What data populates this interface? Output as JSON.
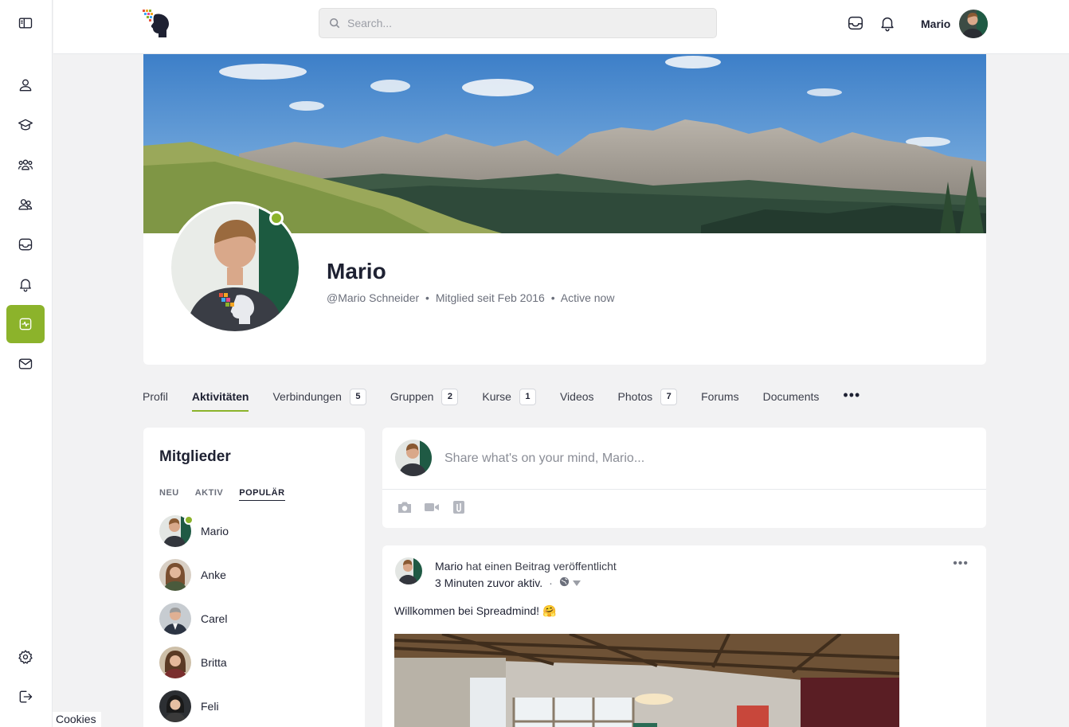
{
  "sidebar": {
    "items": [
      {
        "icon": "panel-toggle-icon"
      },
      {
        "icon": "profile-icon"
      },
      {
        "icon": "courses-icon"
      },
      {
        "icon": "groups-icon"
      },
      {
        "icon": "members-icon"
      },
      {
        "icon": "inbox-icon"
      },
      {
        "icon": "notifications-icon"
      },
      {
        "icon": "activity-icon",
        "active": true
      },
      {
        "icon": "messages-icon"
      },
      {
        "icon": "settings-icon"
      },
      {
        "icon": "logout-icon"
      }
    ]
  },
  "header": {
    "search_placeholder": "Search...",
    "user_name": "Mario"
  },
  "profile": {
    "name": "Mario",
    "handle": "@Mario Schneider",
    "member_since": "Mitglied seit Feb 2016",
    "status": "Active now",
    "meta_sep": "•"
  },
  "tabs": [
    {
      "label": "Profil"
    },
    {
      "label": "Aktivitäten",
      "active": true
    },
    {
      "label": "Verbindungen",
      "count": "5"
    },
    {
      "label": "Gruppen",
      "count": "2"
    },
    {
      "label": "Kurse",
      "count": "1"
    },
    {
      "label": "Videos"
    },
    {
      "label": "Photos",
      "count": "7"
    },
    {
      "label": "Forums"
    },
    {
      "label": "Documents"
    }
  ],
  "tab_more": "•••",
  "members_widget": {
    "title": "Mitglieder",
    "filters": [
      "NEU",
      "AKTIV",
      "POPULÄR"
    ],
    "active_filter": "POPULÄR",
    "members": [
      "Mario",
      "Anke",
      "Carel",
      "Britta",
      "Feli"
    ]
  },
  "composer": {
    "prompt": "Share what's on your mind, Mario..."
  },
  "post": {
    "author": "Mario",
    "action": "hat einen Beitrag veröffentlicht",
    "time": "3 Minuten zuvor aktiv.",
    "dot": "·",
    "text": "Willkommen bei Spreadmind! 🤗",
    "more": "•••"
  },
  "cookies_label": "Cookies",
  "colors": {
    "accent": "#8cb32b",
    "text": "#1e2132",
    "muted": "#6b6f7b",
    "background": "#f2f2f3"
  }
}
